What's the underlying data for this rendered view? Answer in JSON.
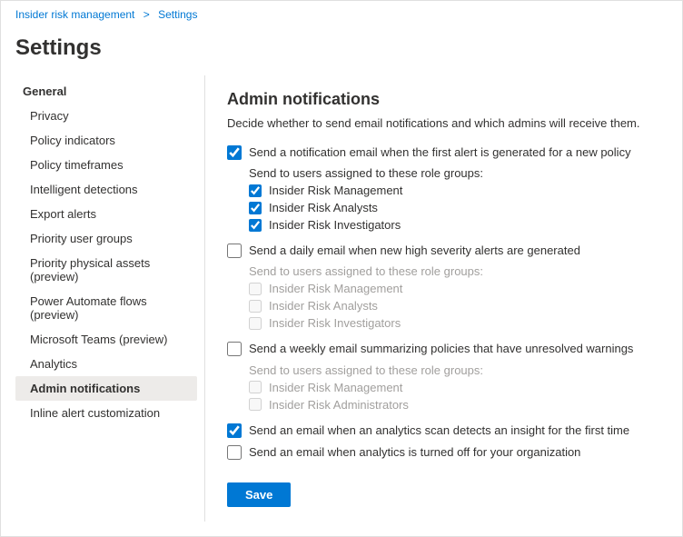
{
  "breadcrumb": {
    "parent": "Insider risk management",
    "separator": ">",
    "current": "Settings"
  },
  "page_title": "Settings",
  "sidebar": {
    "section_header": "General",
    "items": [
      {
        "id": "privacy",
        "label": "Privacy",
        "active": false
      },
      {
        "id": "policy-indicators",
        "label": "Policy indicators",
        "active": false
      },
      {
        "id": "policy-timeframes",
        "label": "Policy timeframes",
        "active": false
      },
      {
        "id": "intelligent-detections",
        "label": "Intelligent detections",
        "active": false
      },
      {
        "id": "export-alerts",
        "label": "Export alerts",
        "active": false
      },
      {
        "id": "priority-user-groups",
        "label": "Priority user groups",
        "active": false
      },
      {
        "id": "priority-physical-assets",
        "label": "Priority physical assets (preview)",
        "active": false
      },
      {
        "id": "power-automate-flows",
        "label": "Power Automate flows (preview)",
        "active": false
      },
      {
        "id": "microsoft-teams",
        "label": "Microsoft Teams (preview)",
        "active": false
      },
      {
        "id": "analytics",
        "label": "Analytics",
        "active": false
      },
      {
        "id": "admin-notifications",
        "label": "Admin notifications",
        "active": true
      },
      {
        "id": "inline-alert-customization",
        "label": "Inline alert customization",
        "active": false
      }
    ]
  },
  "panel": {
    "title": "Admin notifications",
    "description": "Decide whether to send email notifications and which admins will receive them.",
    "sections": [
      {
        "id": "new-policy-alert",
        "main_checked": true,
        "main_enabled": true,
        "main_label": "Send a notification email when the first alert is generated for a new policy",
        "role_groups_label": "Send to users assigned to these role groups:",
        "role_groups": [
          {
            "label": "Insider Risk Management",
            "checked": true,
            "enabled": true
          },
          {
            "label": "Insider Risk Analysts",
            "checked": true,
            "enabled": true
          },
          {
            "label": "Insider Risk Investigators",
            "checked": true,
            "enabled": true
          }
        ]
      },
      {
        "id": "high-severity-alerts",
        "main_checked": false,
        "main_enabled": true,
        "main_label": "Send a daily email when new high severity alerts are generated",
        "role_groups_label": "Send to users assigned to these role groups:",
        "role_groups": [
          {
            "label": "Insider Risk Management",
            "checked": false,
            "enabled": false
          },
          {
            "label": "Insider Risk Analysts",
            "checked": false,
            "enabled": false
          },
          {
            "label": "Insider Risk Investigators",
            "checked": false,
            "enabled": false
          }
        ]
      },
      {
        "id": "unresolved-warnings",
        "main_checked": false,
        "main_enabled": true,
        "main_label": "Send a weekly email summarizing policies that have unresolved warnings",
        "role_groups_label": "Send to users assigned to these role groups:",
        "role_groups": [
          {
            "label": "Insider Risk Management",
            "checked": false,
            "enabled": false
          },
          {
            "label": "Insider Risk Administrators",
            "checked": false,
            "enabled": false
          }
        ]
      }
    ],
    "standalone_checkboxes": [
      {
        "id": "analytics-insight",
        "checked": true,
        "enabled": true,
        "label": "Send an email when an analytics scan detects an insight for the first time"
      },
      {
        "id": "analytics-turned-off",
        "checked": false,
        "enabled": true,
        "label": "Send an email when analytics is turned off for your organization"
      }
    ],
    "save_button_label": "Save"
  }
}
